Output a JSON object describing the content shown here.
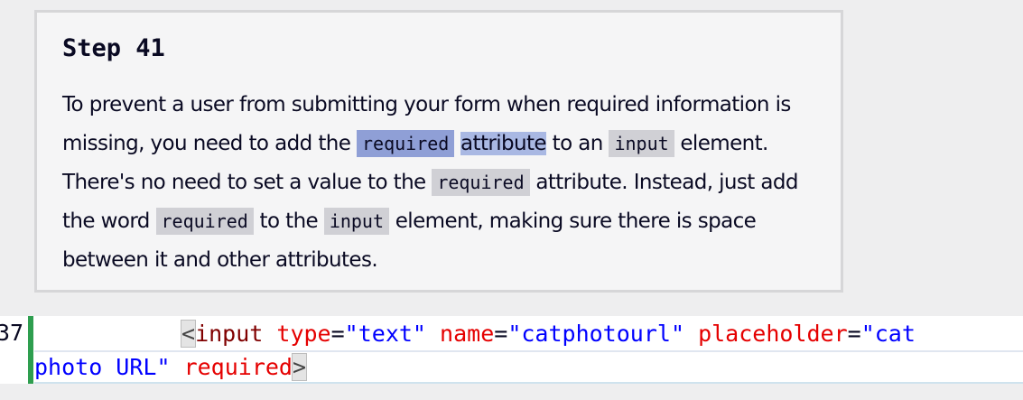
{
  "step": {
    "title": "Step 41"
  },
  "description": {
    "p1": "To prevent a user from submitting your form when required information is missing, you need to add the ",
    "code_required_1": "required",
    "word_attribute": "attribute",
    "p2": " to an ",
    "code_input_1": "input",
    "p3": " element. There's no need to set a value to the ",
    "code_required_2": "required",
    "p4": " attribute. Instead, just add the word ",
    "code_required_3": "required",
    "p5": " to the ",
    "code_input_2": "input",
    "p6": " element, making sure there is space between it and other attributes."
  },
  "editor": {
    "line_number": "37",
    "lt": "<",
    "tag": "input",
    "attr_type": "type",
    "val_type": "\"text\"",
    "attr_name": "name",
    "val_name": "\"catphotourl\"",
    "attr_placeholder": "placeholder",
    "val_placeholder_a": "\"cat",
    "val_placeholder_b": "photo URL\"",
    "attr_required": "required",
    "gt": ">",
    "eq": "="
  }
}
